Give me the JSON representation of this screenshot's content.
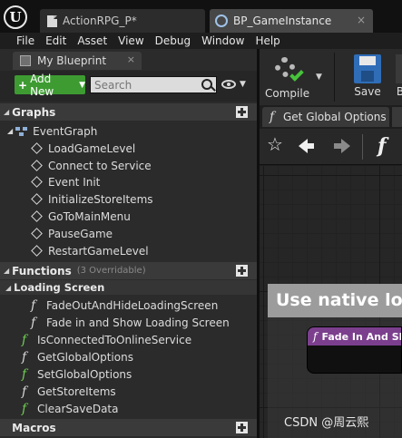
{
  "tabs": [
    {
      "label": "ActionRPG_P*"
    },
    {
      "label": "BP_GameInstance",
      "close": "×"
    }
  ],
  "menu": [
    "File",
    "Edit",
    "Asset",
    "View",
    "Debug",
    "Window",
    "Help"
  ],
  "panel": {
    "tab_label": "My Blueprint",
    "tab_close": "×",
    "add_new_label": "Add New",
    "search_placeholder": "Search"
  },
  "graphs": {
    "title": "Graphs",
    "event_graph": "EventGraph",
    "events": [
      "LoadGameLevel",
      "Connect to Service",
      "Event Init",
      "InitializeStoreItems",
      "GoToMainMenu",
      "PauseGame",
      "RestartGameLevel"
    ]
  },
  "functions": {
    "title": "Functions",
    "hint": "(3 Overridable)",
    "category": "Loading Screen",
    "category_items": [
      "FadeOutAndHideLoadingScreen",
      "Fade in and Show Loading Screen"
    ],
    "items": [
      "IsConnectedToOnlineService",
      "GetGlobalOptions",
      "SetGlobalOptions",
      "GetStoreItems",
      "ClearSaveData"
    ]
  },
  "macros": {
    "title": "Macros"
  },
  "toolbar": {
    "compile": "Compile",
    "save": "Save",
    "overflow": "B"
  },
  "graph_tab": {
    "label": "Get Global Options"
  },
  "canvas": {
    "comment_text": "Use native loa",
    "node_title": "Fade In And Sh"
  },
  "watermark": "CSDN @周云熙",
  "colors": {
    "add_new": "#3d9b32",
    "function_icon": "#6ecf52",
    "node_header": "#7b3f8d",
    "compile_check": "#47c23b"
  }
}
